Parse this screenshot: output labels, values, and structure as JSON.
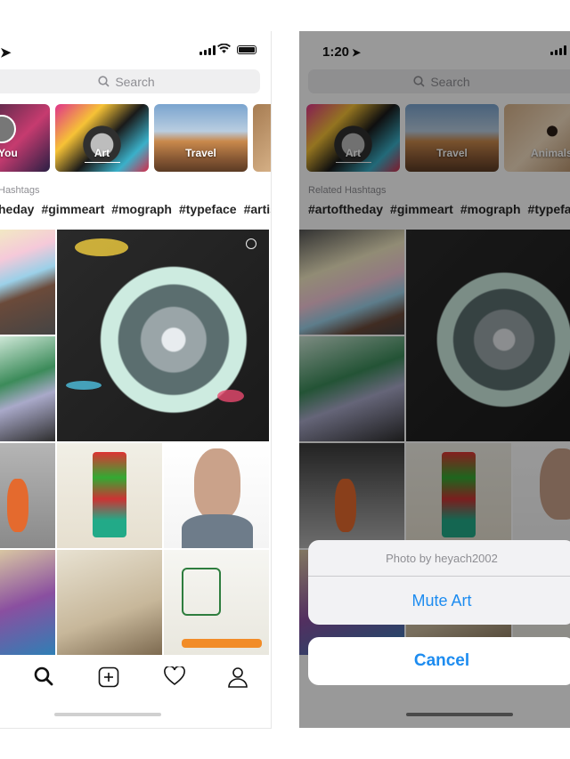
{
  "left_screen": {
    "search_placeholder": "Search",
    "categories": [
      {
        "label": "You"
      },
      {
        "label": "Art"
      },
      {
        "label": "Travel"
      }
    ],
    "related_hashtags_label": "Hashtags",
    "hashtags": [
      "heday",
      "#gimmeart",
      "#mograph",
      "#typeface",
      "#artis"
    ]
  },
  "right_screen": {
    "status_time": "1:20",
    "search_placeholder": "Search",
    "categories": [
      {
        "label": "Art"
      },
      {
        "label": "Travel"
      },
      {
        "label": "Animals"
      }
    ],
    "related_hashtags_label": "Related Hashtags",
    "hashtags": [
      "#artoftheday",
      "#gimmeart",
      "#mograph",
      "#typefac"
    ],
    "action_sheet": {
      "title": "Photo by heyach2002",
      "mute_label": "Mute Art",
      "cancel_label": "Cancel"
    }
  },
  "tab_icons": [
    "search-icon",
    "add-post-icon",
    "heart-icon",
    "profile-icon"
  ],
  "colors": {
    "accent_blue": "#1d8cf0",
    "overlay": "rgba(0,0,0,0.40)"
  }
}
